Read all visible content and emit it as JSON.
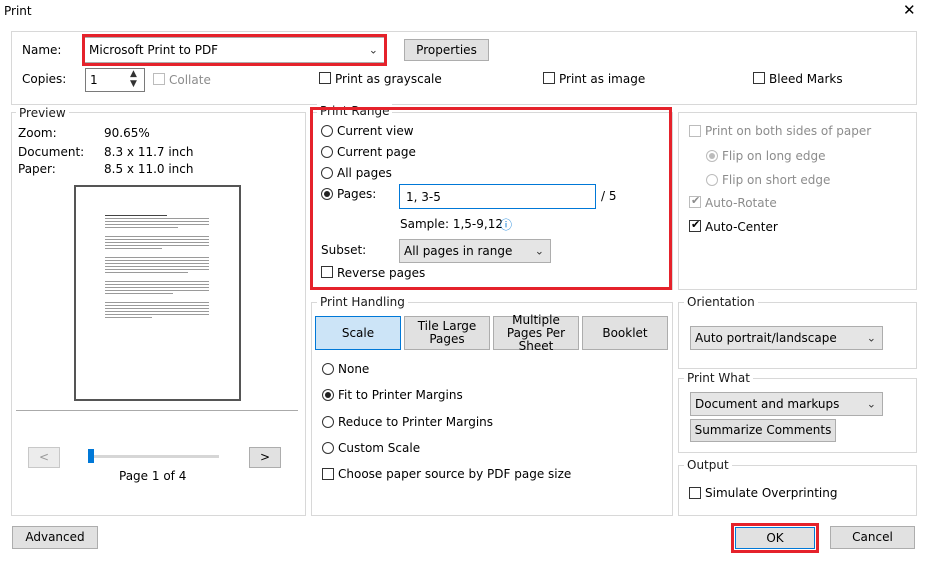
{
  "window": {
    "title": "Print",
    "close_glyph": "✕"
  },
  "top": {
    "name_label": "Name:",
    "printer": "Microsoft Print to PDF",
    "properties_label": "Properties",
    "copies_label": "Copies:",
    "copies_value": "1",
    "collate_label": "Collate",
    "grayscale_label": "Print as grayscale",
    "image_label": "Print as image",
    "bleed_label": "Bleed Marks"
  },
  "preview": {
    "title": "Preview",
    "zoom_label": "Zoom:",
    "zoom_value": "90.65%",
    "document_label": "Document:",
    "document_value": "8.3 x 11.7 inch",
    "paper_label": "Paper:",
    "paper_value": "8.5 x 11.0 inch",
    "prev_glyph": "<",
    "next_glyph": ">",
    "page_text": "Page 1 of 4",
    "slider_position": 0.0
  },
  "print_range": {
    "title": "Print Range",
    "current_view": "Current view",
    "current_page": "Current page",
    "all_pages": "All pages",
    "pages_label": "Pages:",
    "pages_value": "1, 3-5",
    "total_pages": "/ 5",
    "sample": "Sample: 1,5-9,12",
    "info_glyph": "ⓘ",
    "subset_label": "Subset:",
    "subset_value": "All pages in range",
    "reverse_label": "Reverse pages"
  },
  "print_handling": {
    "title": "Print Handling",
    "tabs": [
      "Scale",
      "Tile Large Pages",
      "Multiple Pages Per Sheet",
      "Booklet"
    ],
    "none_label": "None",
    "fit_label": "Fit to Printer Margins",
    "reduce_label": "Reduce to Printer Margins",
    "custom_label": "Custom Scale",
    "paper_source_label": "Choose paper source by PDF page size"
  },
  "duplex": {
    "both_sides_label": "Print on both sides of paper",
    "long_edge_label": "Flip on long edge",
    "short_edge_label": "Flip on short edge",
    "auto_rotate_label": "Auto-Rotate",
    "auto_center_label": "Auto-Center"
  },
  "orientation": {
    "title": "Orientation",
    "value": "Auto portrait/landscape"
  },
  "print_what": {
    "title": "Print What",
    "value": "Document and markups",
    "summarize_label": "Summarize Comments"
  },
  "output": {
    "title": "Output",
    "simulate_label": "Simulate Overprinting"
  },
  "footer": {
    "advanced_label": "Advanced",
    "ok_label": "OK",
    "cancel_label": "Cancel"
  },
  "colors": {
    "highlight": "#e5222b",
    "selected_tab": "#cce4f7",
    "slider_thumb": "#0078d7"
  },
  "icons": {
    "close": "close-icon",
    "info": "info-icon",
    "chevron": "chevron-down-icon",
    "spinner": "spin-arrows-icon"
  }
}
